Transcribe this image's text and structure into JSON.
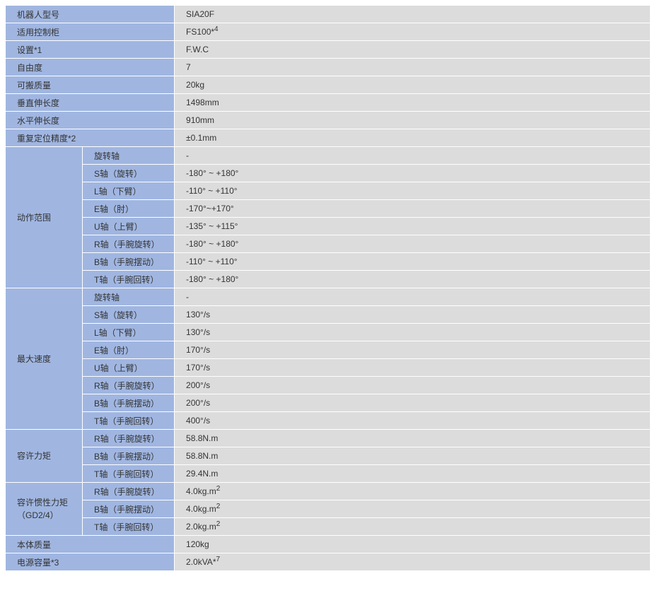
{
  "rows_top": [
    {
      "label": "机器人型号",
      "value": "SIA20F"
    },
    {
      "label": "适用控制柜",
      "value": "FS100*",
      "sup": "4"
    },
    {
      "label": "设置*1",
      "value": "F.W.C"
    },
    {
      "label": "自由度",
      "value": "7"
    },
    {
      "label": "可搬质量",
      "value": "20kg"
    },
    {
      "label": "垂直伸长度",
      "value": "1498mm"
    },
    {
      "label": "水平伸长度",
      "value": "910mm"
    },
    {
      "label": "重复定位精度*2",
      "value": "±0.1mm"
    }
  ],
  "groups": [
    {
      "label": "动作范围",
      "rows": [
        {
          "sub": "旋转轴",
          "value": "-"
        },
        {
          "sub": "S轴（旋转）",
          "value": "-180° ~ +180°"
        },
        {
          "sub": "L轴（下臂）",
          "value": "-110° ~ +110°"
        },
        {
          "sub": "E轴（肘）",
          "value": "-170°~+170°"
        },
        {
          "sub": "U轴（上臂）",
          "value": "-135° ~ +115°"
        },
        {
          "sub": "R轴（手腕旋转）",
          "value": "-180° ~ +180°"
        },
        {
          "sub": "B轴（手腕摆动）",
          "value": "-110° ~ +110°"
        },
        {
          "sub": "T轴（手腕回转）",
          "value": "-180° ~ +180°"
        }
      ]
    },
    {
      "label": "最大速度",
      "rows": [
        {
          "sub": "旋转轴",
          "value": "-"
        },
        {
          "sub": "S轴（旋转）",
          "value": "130°/s"
        },
        {
          "sub": "L轴（下臂）",
          "value": "130°/s"
        },
        {
          "sub": "E轴（肘）",
          "value": "170°/s"
        },
        {
          "sub": "U轴（上臂）",
          "value": "170°/s"
        },
        {
          "sub": "R轴（手腕旋转）",
          "value": "200°/s"
        },
        {
          "sub": "B轴（手腕摆动）",
          "value": "200°/s"
        },
        {
          "sub": "T轴（手腕回转）",
          "value": "400°/s"
        }
      ]
    },
    {
      "label": "容许力矩",
      "rows": [
        {
          "sub": "R轴（手腕旋转）",
          "value": "58.8N.m"
        },
        {
          "sub": "B轴（手腕摆动）",
          "value": "58.8N.m"
        },
        {
          "sub": "T轴（手腕回转）",
          "value": "29.4N.m"
        }
      ]
    },
    {
      "label": "容许惯性力矩",
      "label2": "（GD2/4）",
      "rows": [
        {
          "sub": "R轴（手腕旋转）",
          "value": "4.0kg.m",
          "sup": "2"
        },
        {
          "sub": "B轴（手腕摆动）",
          "value": "4.0kg.m",
          "sup": "2"
        },
        {
          "sub": "T轴（手腕回转）",
          "value": "2.0kg.m",
          "sup": "2"
        }
      ]
    }
  ],
  "rows_bottom": [
    {
      "label": "本体质量",
      "value": "120kg"
    },
    {
      "label": "电源容量*3",
      "value": "2.0kVA*",
      "sup": "7"
    }
  ]
}
